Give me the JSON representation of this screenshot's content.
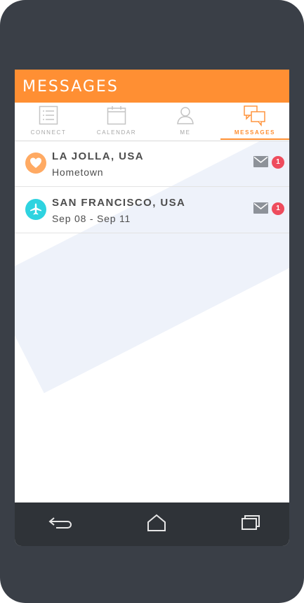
{
  "header": {
    "title": "MESSAGES"
  },
  "tabs": [
    {
      "label": "CONNECT",
      "icon": "list-icon",
      "active": false
    },
    {
      "label": "CALENDAR",
      "icon": "calendar-icon",
      "active": false
    },
    {
      "label": "ME",
      "icon": "person-icon",
      "active": false
    },
    {
      "label": "MESSAGES",
      "icon": "chat-bubbles-icon",
      "active": true
    }
  ],
  "conversations": [
    {
      "title": "LA JOLLA, USA",
      "subtitle": "Hometown",
      "icon": "heart-icon",
      "icon_color": "#ffaa63",
      "unread": "1"
    },
    {
      "title": "SAN FRANCISCO, USA",
      "subtitle": "Sep 08 - Sep 11",
      "icon": "airplane-icon",
      "icon_color": "#2ed3e0",
      "unread": "1"
    }
  ],
  "navbar": {
    "buttons": [
      "back-icon",
      "home-icon",
      "recent-apps-icon"
    ]
  },
  "colors": {
    "accent": "#ff8f33",
    "badge": "#ee4c5d",
    "frame": "#3a3f47",
    "navbar": "#2f3338"
  }
}
